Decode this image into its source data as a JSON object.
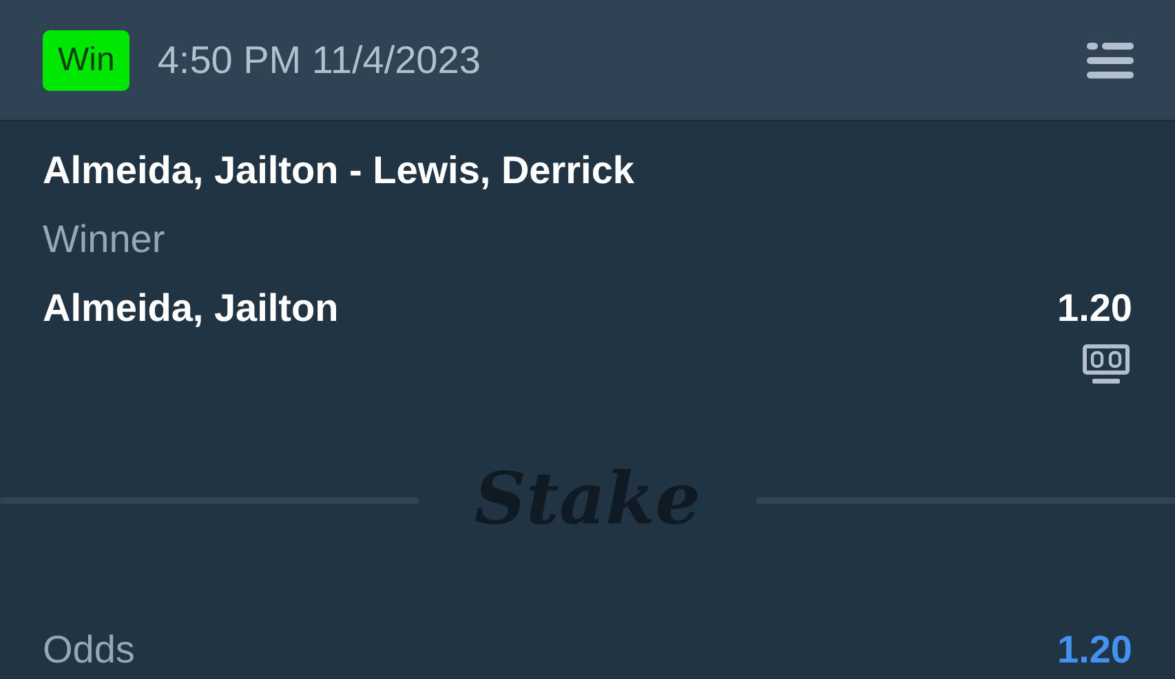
{
  "header": {
    "status": {
      "label": "Win",
      "kind": "win"
    },
    "timestamp": "4:50 PM 11/4/2023"
  },
  "bet": {
    "event": "Almeida, Jailton - Lewis, Derrick",
    "market": "Winner",
    "selection": "Almeida, Jailton",
    "odds": "1.20"
  },
  "divider": {
    "logo": "Stake"
  },
  "summary": [
    {
      "label": "Odds",
      "value": "1.20"
    }
  ]
}
